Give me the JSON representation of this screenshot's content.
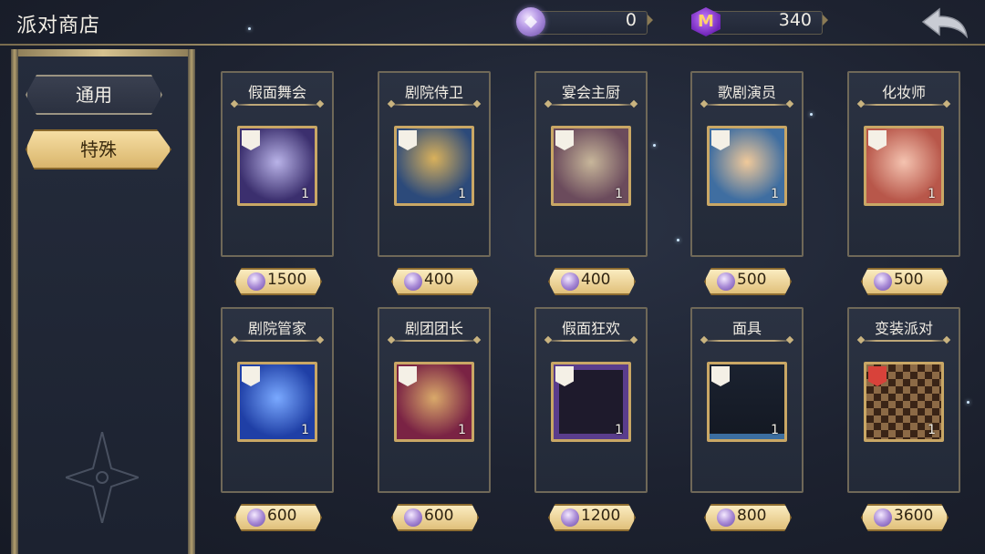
{
  "header": {
    "title": "派对商店",
    "currency_party": {
      "value": "0",
      "icon": "party-gem-icon"
    },
    "currency_m": {
      "value": "340",
      "icon": "m-crystal-icon",
      "glyph": "M"
    },
    "back_icon": "back-arrow-icon"
  },
  "sidebar": {
    "tabs": [
      {
        "label": "通用",
        "state": "normal"
      },
      {
        "label": "特殊",
        "state": "active"
      }
    ]
  },
  "items": [
    {
      "name": "假面舞会",
      "qty": "1",
      "price": "1500",
      "badge": "card-icon",
      "art": "#3b2f6e"
    },
    {
      "name": "剧院侍卫",
      "qty": "1",
      "price": "400",
      "badge": "helmet-icon",
      "art": "#2c4a7a"
    },
    {
      "name": "宴会主厨",
      "qty": "1",
      "price": "400",
      "badge": "helmet-icon",
      "art": "#6b4b5c"
    },
    {
      "name": "歌剧演员",
      "qty": "1",
      "price": "500",
      "badge": "helmet-icon",
      "art": "#3f6ea1"
    },
    {
      "name": "化妆师",
      "qty": "1",
      "price": "500",
      "badge": "helmet-icon",
      "art": "#b8574a"
    },
    {
      "name": "剧院管家",
      "qty": "1",
      "price": "600",
      "badge": "helmet-icon",
      "art": "#1f3fa6"
    },
    {
      "name": "剧团团长",
      "qty": "1",
      "price": "600",
      "badge": "helmet-icon",
      "art": "#7a2344"
    },
    {
      "name": "假面狂欢",
      "qty": "1",
      "price": "1200",
      "badge": "frame-icon",
      "art": "#2a1f3c"
    },
    {
      "name": "面具",
      "qty": "1",
      "price": "800",
      "badge": "nameplate-icon",
      "art": "#1b2230"
    },
    {
      "name": "变装派对",
      "qty": "1",
      "price": "3600",
      "badge": "board-icon",
      "art": "#5b3a22"
    }
  ],
  "colors": {
    "accent_gold": "#c9a765",
    "price_bg": "#f0d596",
    "panel_bg": "#2b3242",
    "active_tab": "#e9c984"
  }
}
